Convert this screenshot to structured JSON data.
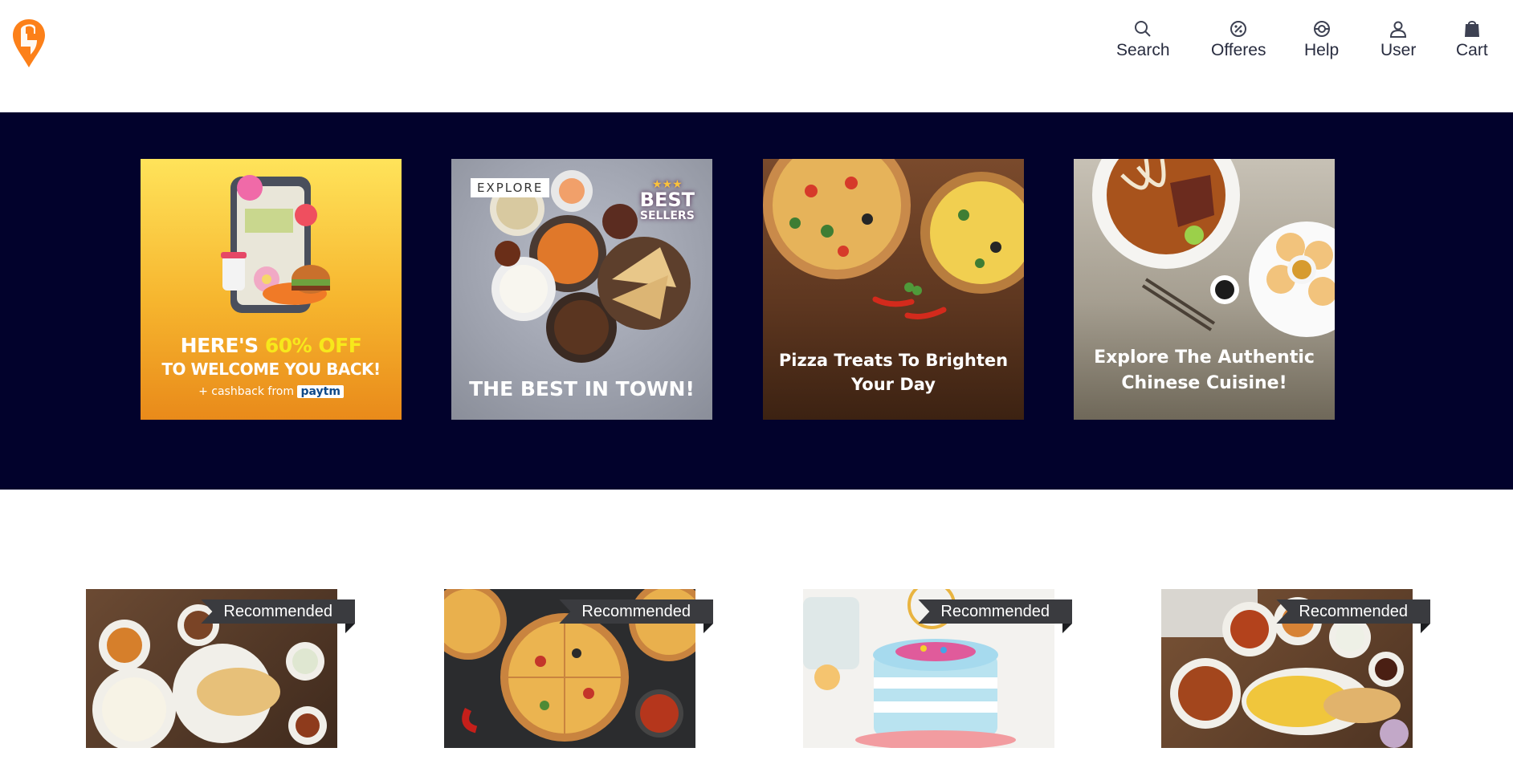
{
  "header": {
    "logo": "swiggy-logo",
    "nav": [
      {
        "label": "Search",
        "icon": "search-icon"
      },
      {
        "label": "Offeres",
        "icon": "offer-icon"
      },
      {
        "label": "Help",
        "icon": "help-icon"
      },
      {
        "label": "User",
        "icon": "user-icon"
      },
      {
        "label": "Cart",
        "icon": "cart-icon"
      }
    ]
  },
  "banner": {
    "background": "#02022c",
    "promos": [
      {
        "line1_a": "HERE'S ",
        "line1_b": "60% OFF",
        "line2": "TO WELCOME YOU BACK!",
        "line3": "+ cashback from",
        "brand": "paytm"
      },
      {
        "tag": "EXPLORE",
        "badge_1": "BEST",
        "badge_2": "SELLERS",
        "caption": "THE BEST IN TOWN!"
      },
      {
        "caption_1": "Pizza Treats To Brighten",
        "caption_2": "Your Day"
      },
      {
        "caption_1": "Explore The Authentic",
        "caption_2": "Chinese Cuisine!"
      }
    ]
  },
  "recommended": [
    {
      "label": "Recommended",
      "image": "north-indian-thali"
    },
    {
      "label": "Recommended",
      "image": "pizzas"
    },
    {
      "label": "Recommended",
      "image": "birthday-cake"
    },
    {
      "label": "Recommended",
      "image": "biryani-curry-spread"
    }
  ],
  "colors": {
    "brand": "#fc8019",
    "banner": "#02022c",
    "ribbon": "#3a3b3f",
    "highlight": "#f7e81b"
  }
}
